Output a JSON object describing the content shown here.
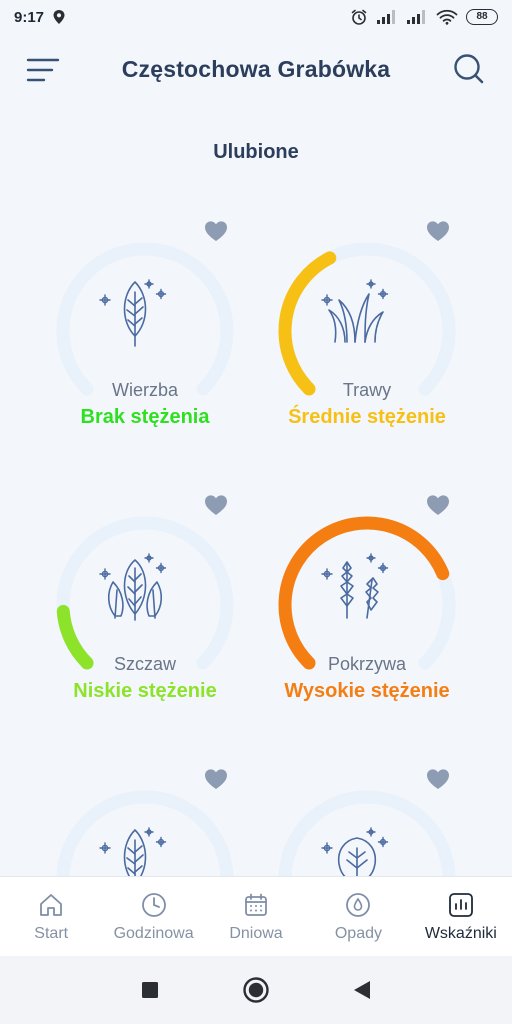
{
  "status_bar": {
    "time": "9:17",
    "battery": "88"
  },
  "header": {
    "title": "Częstochowa Grabówka"
  },
  "section": {
    "title": "Ulubione"
  },
  "cards": [
    {
      "name": "Wierzba",
      "level": "Brak stężenia",
      "level_color": "#2ee01f",
      "gauge_fraction": 0,
      "icon": "leaf-icon"
    },
    {
      "name": "Trawy",
      "level": "Średnie stężenie",
      "level_color": "#f6c015",
      "gauge_fraction": 0.4,
      "icon": "grass-icon"
    },
    {
      "name": "Szczaw",
      "level": "Niskie stężenie",
      "level_color": "#8ce32a",
      "gauge_fraction": 0.15,
      "icon": "sorrel-icon"
    },
    {
      "name": "Pokrzywa",
      "level": "Wysokie stężenie",
      "level_color": "#f57e12",
      "gauge_fraction": 0.75,
      "icon": "nettle-icon"
    },
    {
      "name": "",
      "level": "",
      "level_color": "#2ee01f",
      "gauge_fraction": 0,
      "icon": "leaf-icon"
    },
    {
      "name": "",
      "level": "",
      "level_color": "#2ee01f",
      "gauge_fraction": 0,
      "icon": "tree-icon"
    }
  ],
  "bottom_nav": [
    {
      "label": "Start",
      "icon": "home-icon"
    },
    {
      "label": "Godzinowa",
      "icon": "clock-icon"
    },
    {
      "label": "Dniowa",
      "icon": "calendar-icon"
    },
    {
      "label": "Opady",
      "icon": "drop-icon"
    },
    {
      "label": "Wskaźniki",
      "icon": "chart-icon",
      "active": true
    }
  ],
  "colors": {
    "accent": "#2c3e5c",
    "gauge_track": "#e9f1fa",
    "icon_stroke": "#4a6aa0",
    "heart": "#8d9bb3"
  }
}
